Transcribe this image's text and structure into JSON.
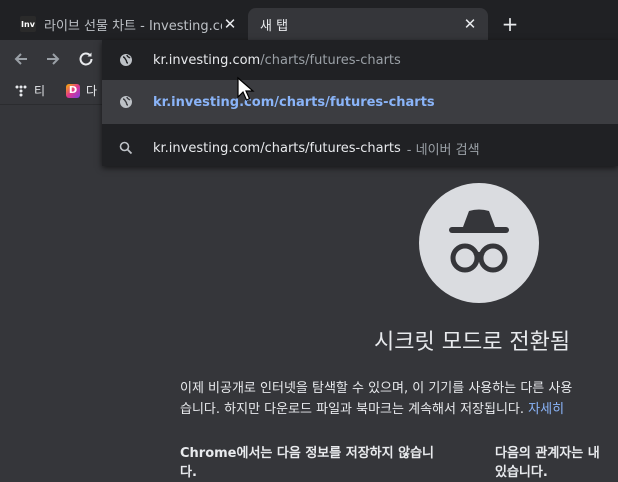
{
  "colors": {
    "frame": "#202124",
    "toolbar": "#35363a",
    "accent": "#8ab4f8",
    "text": "#e8eaed",
    "muted": "#9aa0a6"
  },
  "tabs": [
    {
      "title": "라이브 선물 차트 - Investing.com",
      "favicon_text": "Inv",
      "favicon": "investing-favicon",
      "active": false
    },
    {
      "title": "새 탭",
      "active": true
    }
  ],
  "newtab_label": "+",
  "omnibox": {
    "input_host": "kr.investing.com",
    "input_path": "/charts/futures-charts",
    "suggestions": [
      {
        "icon": "globe-icon",
        "text": "kr.investing.com/charts/futures-charts",
        "selected": true
      },
      {
        "icon": "search-icon",
        "text": "kr.investing.com/charts/futures-charts",
        "suffix": "- 네이버 검색"
      }
    ]
  },
  "bookmarks": [
    {
      "label": "티",
      "icon": "t-logo-icon"
    },
    {
      "label": "다",
      "icon": "d-logo-icon",
      "icon_text": "D"
    }
  ],
  "incognito": {
    "heading": "시크릿 모드로 전환됨",
    "para_line1": "이제 비공개로 인터넷을 탐색할 수 있으며, 이 기기를 사용하는 다른 사용",
    "para_line2": "습니다. 하지만 다운로드 파일과 북마크는 계속해서 저장됩니다.",
    "learn_more": "자세히",
    "col1_line1": "Chrome에서는 다음 정보를 저장하지 않습니",
    "col1_line2": "다.",
    "col2_line1": "다음의 관계자는 내 ",
    "col2_line2": "있습니다."
  }
}
